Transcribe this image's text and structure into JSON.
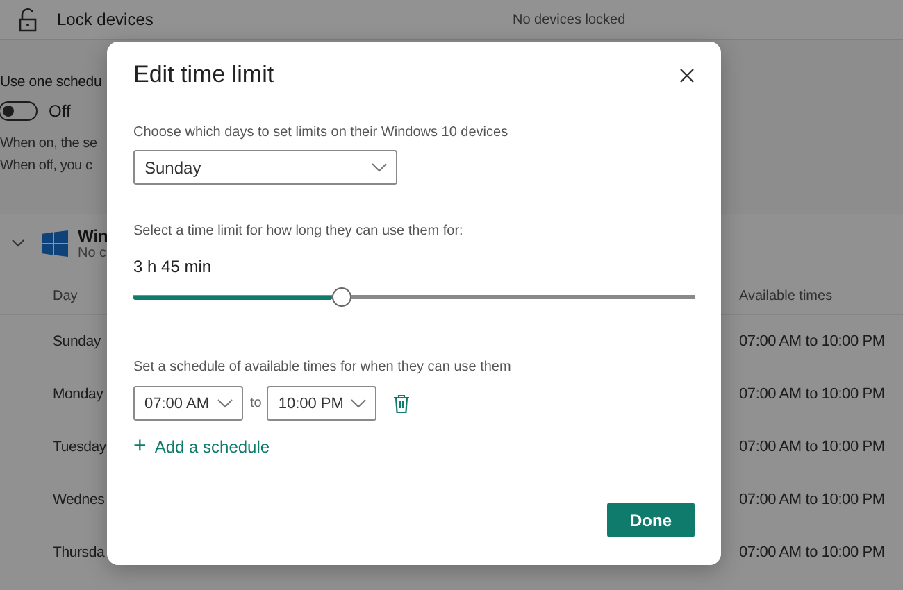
{
  "background": {
    "lock_row": {
      "label": "Lock devices",
      "status": "No devices locked"
    },
    "schedule_toggle": {
      "label": "Use one schedu",
      "on": false,
      "state_label": "Off"
    },
    "description": [
      "When on, the se",
      "When off, you c"
    ],
    "device": {
      "name": "Win",
      "status": "No c",
      "expanded": true
    },
    "table": {
      "columns": [
        "Day",
        "Available times"
      ],
      "rows": [
        {
          "day": "Sunday",
          "times": "07:00 AM to 10:00 PM"
        },
        {
          "day": "Monday",
          "times": "07:00 AM to 10:00 PM"
        },
        {
          "day": "Tuesday",
          "times": "07:00 AM to 10:00 PM"
        },
        {
          "day": "Wednes",
          "times": "07:00 AM to 10:00 PM"
        },
        {
          "day": "Thursda",
          "times": "07:00 AM to 10:00 PM"
        }
      ]
    }
  },
  "dialog": {
    "title": "Edit time limit",
    "days_label": "Choose which days to set limits on their Windows 10 devices",
    "day_select": "Sunday",
    "limit_label": "Select a time limit for how long they can use them for:",
    "limit_value": "3 h 45 min",
    "slider": {
      "level": 0.354
    },
    "schedule_label": "Set a schedule of available times for when they can use them",
    "schedule": {
      "from": "07:00 AM",
      "separator": "to",
      "to": "10:00 PM"
    },
    "add_link": "Add a schedule",
    "add_icon": "+",
    "done": "Done"
  }
}
